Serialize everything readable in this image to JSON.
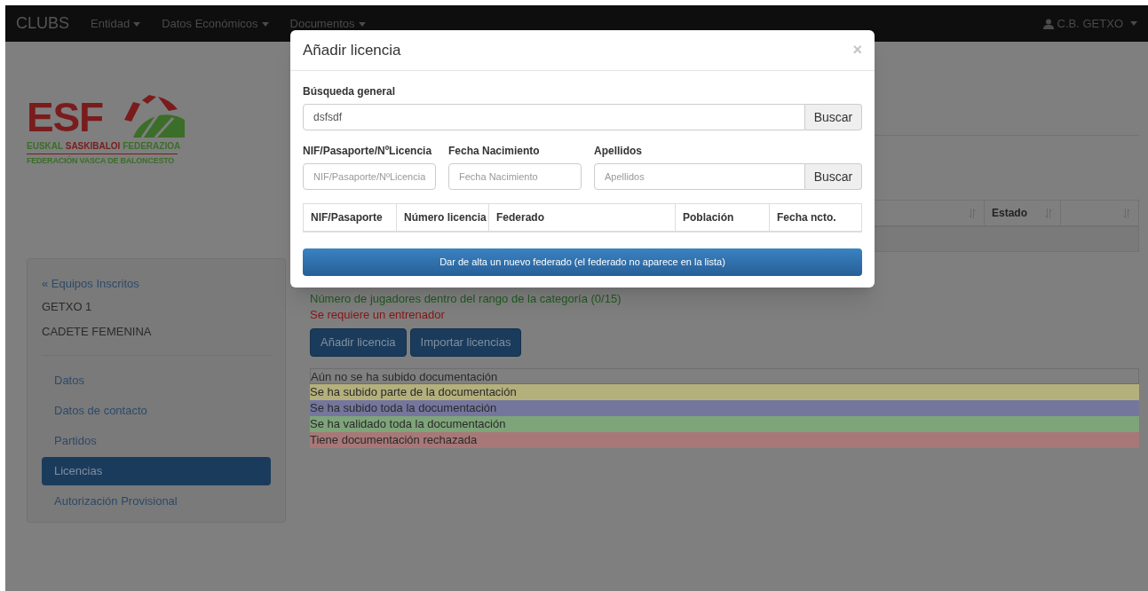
{
  "navbar": {
    "brand": "CLUBS",
    "menus": [
      {
        "label": "Entidad"
      },
      {
        "label": "Datos Económicos"
      },
      {
        "label": "Documentos"
      }
    ],
    "user": "C.B. GETXO"
  },
  "logo": {
    "letters": "ESF",
    "line1": [
      "EUSKAL",
      "SASKIBALOI",
      "FEDERAZIOA"
    ],
    "line2": "FEDERACIÓN VASCA DE BALONCESTO"
  },
  "sidebar": {
    "back_link": "« Equipos Inscritos",
    "team": "GETXO 1",
    "category": "CADETE FEMENINA",
    "items": [
      {
        "label": "Datos",
        "selected": false
      },
      {
        "label": "Datos de contacto",
        "selected": false
      },
      {
        "label": "Partidos",
        "selected": false
      },
      {
        "label": "Licencias",
        "selected": true
      },
      {
        "label": "Autorización Provisional",
        "selected": false
      }
    ]
  },
  "table": {
    "columns": [
      {
        "sortable": true
      },
      {
        "label": "Estado",
        "sortable": true
      },
      {
        "sortable": true
      }
    ]
  },
  "messages": [
    {
      "text": "Número de jugadores dentro del rango de la categoría (0/15)",
      "kind": "ok"
    },
    {
      "text": "Se requiere un entrenador",
      "kind": "error"
    }
  ],
  "buttons": [
    "Añadir licencia",
    "Importar licencias"
  ],
  "legend": [
    {
      "text": "Aún no se ha subido documentación",
      "color": "#808080"
    },
    {
      "text": "Se ha subido parte de la documentación",
      "color": "#b4b07c"
    },
    {
      "text": "Se ha subido toda la documentación",
      "color": "#75769e"
    },
    {
      "text": "Se ha validado toda la documentación",
      "color": "#7ea47a"
    },
    {
      "text": "Tiene documentación rechazada",
      "color": "#a87878"
    }
  ],
  "modal": {
    "title": "Añadir licencia",
    "close": "×",
    "general_label": "Búsqueda general",
    "general_value": "dsfsdf",
    "search_button": "Buscar",
    "fields": [
      {
        "label": "NIF/Pasaporte/NºLicencia",
        "placeholder": "NIF/Pasaporte/NºLicencia"
      },
      {
        "label": "Fecha Nacimiento",
        "placeholder": "Fecha Nacimiento"
      },
      {
        "label": "Apellidos",
        "placeholder": "Apellidos"
      }
    ],
    "fields_button": "Buscar",
    "columns": [
      "NIF/Pasaporte",
      "Número licencia",
      "Federado",
      "Población",
      "Fecha ncto."
    ],
    "new_button": "Dar de alta un nuevo federado (el federado no aparece en la lista)"
  }
}
